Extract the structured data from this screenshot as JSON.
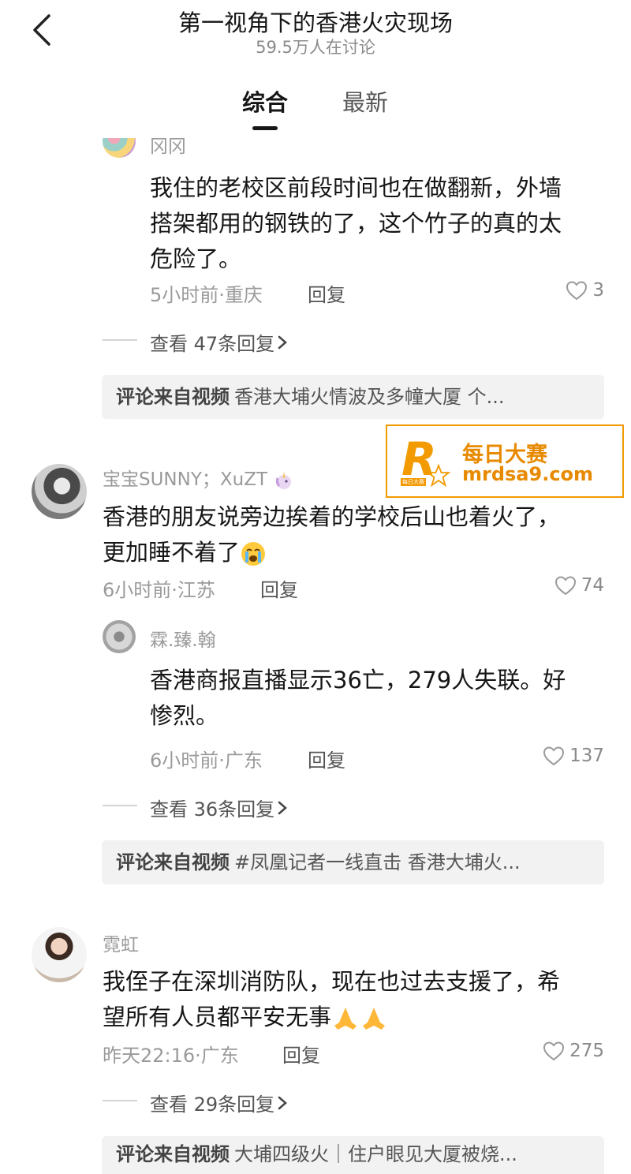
{
  "header": {
    "title": "第一视角下的香港火灾现场",
    "subtitle": "59.5万人在讨论",
    "tabs": [
      {
        "label": "综合",
        "active": true
      },
      {
        "label": "最新",
        "active": false
      }
    ]
  },
  "comments": [
    {
      "username": "冈冈",
      "content": [
        "我住的老校区前段时间也在做翻新，外墙",
        "搭架都用的钢铁的了，这个竹子的真的太",
        "危险了。"
      ],
      "meta": "5小时前·重庆",
      "reply_label": "回复",
      "likes": "3",
      "view_replies": "查看 47条回复",
      "source_label": "评论来自视频",
      "source_text": "香港大埔火情波及多幢大厦 个..."
    },
    {
      "username": "宝宝SUNNY；XuZT",
      "content": [
        "香港的朋友说旁边挨着的学校后山也着火了，",
        "更加睡不着了"
      ],
      "meta": "6小时前·江苏",
      "reply_label": "回复",
      "likes": "74"
    },
    {
      "username": "霖.臻.翰",
      "content": [
        "香港商报直播显示36亡，279人失联。好",
        "惨烈。"
      ],
      "meta": "6小时前·广东",
      "reply_label": "回复",
      "likes": "137",
      "view_replies": "查看 36条回复",
      "source_label": "评论来自视频",
      "source_text": "#凤凰记者一线直击 香港大埔火..."
    },
    {
      "username": "霓虹",
      "content": [
        "我侄子在深圳消防队，现在也过去支援了，希",
        "望所有人员都平安无事"
      ],
      "meta": "昨天22:16·广东",
      "reply_label": "回复",
      "likes": "275",
      "view_replies": "查看 29条回复",
      "source_label": "评论来自视频",
      "source_text": "大埔四级火｜住户眼见大厦被烧..."
    }
  ],
  "watermark": {
    "logo_letter": "R",
    "logo_small": "每日大赛",
    "name": "每日大赛",
    "url": "mrdsa9.com"
  },
  "colors": {
    "text": "#161616",
    "muted": "#9a9a9a",
    "source_bg": "#f2f2f2",
    "watermark": "#f29a00"
  },
  "icons": [
    "back-chevron-icon",
    "heart-outline-icon",
    "chevron-right-icon",
    "crying-face-emoji",
    "praying-hands-emoji",
    "unicorn-emoji"
  ]
}
